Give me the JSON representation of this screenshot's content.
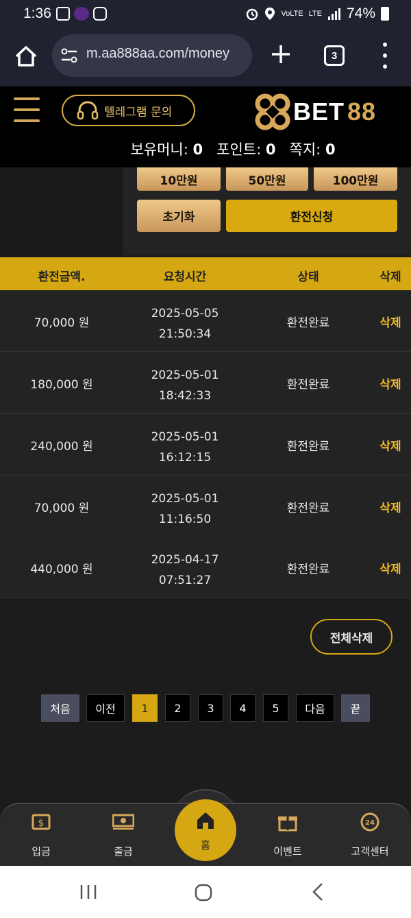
{
  "status_bar": {
    "time": "1:36",
    "lte": "LTE",
    "volte": "VoLTE",
    "battery_text": "74%"
  },
  "browser": {
    "url": "m.aa888aa.com/money",
    "tab_count": "3"
  },
  "header": {
    "telegram_label": "텔레그램 문의",
    "logo_bet": "BET",
    "logo_num": "88",
    "balance_label": "보유머니:",
    "balance_value": "0",
    "point_label": "포인트:",
    "point_value": "0",
    "message_label": "쪽지:",
    "message_value": "0"
  },
  "amount_buttons": {
    "btn_100k": "10만원",
    "btn_500k": "50만원",
    "btn_1m": "100만원",
    "reset": "초기화",
    "submit": "환전신청"
  },
  "table": {
    "headers": {
      "amount": "환전금액.",
      "time": "요청시간",
      "status": "상태",
      "delete": "삭제"
    },
    "rows": [
      {
        "amount": "70,000 원",
        "date": "2025-05-05",
        "clock": "21:50:34",
        "status": "환전완료",
        "delete": "삭제"
      },
      {
        "amount": "180,000 원",
        "date": "2025-05-01",
        "clock": "18:42:33",
        "status": "환전완료",
        "delete": "삭제"
      },
      {
        "amount": "240,000 원",
        "date": "2025-05-01",
        "clock": "16:12:15",
        "status": "환전완료",
        "delete": "삭제"
      },
      {
        "amount": "70,000 원",
        "date": "2025-05-01",
        "clock": "11:16:50",
        "status": "환전완료",
        "delete": "삭제"
      },
      {
        "amount": "440,000 원",
        "date": "2025-04-17",
        "clock": "07:51:27",
        "status": "환전완료",
        "delete": "삭제"
      }
    ]
  },
  "delete_all": "전체삭제",
  "pagination": {
    "first": "처음",
    "prev": "이전",
    "pages": [
      "1",
      "2",
      "3",
      "4",
      "5"
    ],
    "current": "1",
    "next": "다음",
    "last": "끝"
  },
  "bottom_nav": {
    "deposit": "입금",
    "withdraw": "출금",
    "home": "홈",
    "event": "이벤트",
    "support": "고객센터"
  },
  "colors": {
    "accent_gold": "#d5a712",
    "delete_text": "#f2b824",
    "button_gold": "#e2b478"
  }
}
